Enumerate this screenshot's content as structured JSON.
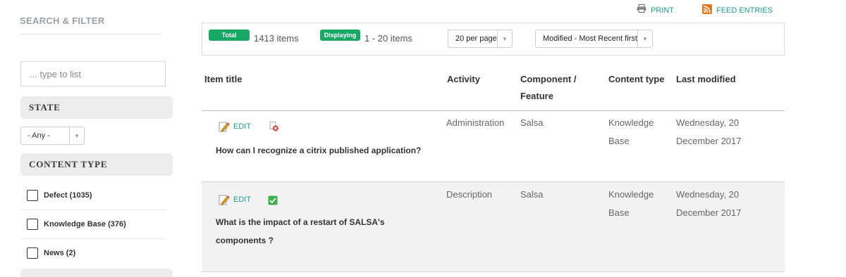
{
  "sidebar": {
    "title": "SEARCH & FILTER",
    "search_placeholder": "... type to list",
    "state": {
      "heading": "STATE",
      "selected": "- Any -"
    },
    "content_type": {
      "heading": "CONTENT TYPE",
      "options": [
        {
          "label": "Defect (1035)",
          "checked": false
        },
        {
          "label": "Knowledge Base (376)",
          "checked": false
        },
        {
          "label": "News (2)",
          "checked": false
        }
      ]
    }
  },
  "toolbar": {
    "print_label": "PRINT",
    "feed_label": "FEED ENTRIES"
  },
  "summary": {
    "total_badge": "Total",
    "total_text": "1413 items",
    "displaying_badge": "Displaying",
    "displaying_text": "1 - 20 items",
    "per_page": "20 per page",
    "sort": "Modified - Most Recent first"
  },
  "table": {
    "headers": {
      "title": "Item title",
      "activity": "Activity",
      "component_line1": "Component /",
      "component_line2": "Feature",
      "content_type": "Content type",
      "last_modified": "Last modified"
    },
    "rows": [
      {
        "edit_label": "EDIT",
        "status_icon": "unpublished-icon",
        "title": "How can I recognize a citrix published application?",
        "activity": "Administration",
        "component": "Salsa",
        "content_type_line1": "Knowledge",
        "content_type_line2": "Base",
        "modified_line1": "Wednesday, 20",
        "modified_line2": "December 2017"
      },
      {
        "edit_label": "EDIT",
        "status_icon": "published-check-icon",
        "title_line1": "What is the impact of a restart of SALSA's",
        "title_line2": "components ?",
        "activity": "Description",
        "component": "Salsa",
        "content_type_line1": "Knowledge",
        "content_type_line2": "Base",
        "modified_line1": "Wednesday, 20",
        "modified_line2": "December 2017"
      }
    ]
  },
  "colors": {
    "accent": "#1e9e8e",
    "badge": "#17a864",
    "row_alt": "#f2f2f2"
  }
}
